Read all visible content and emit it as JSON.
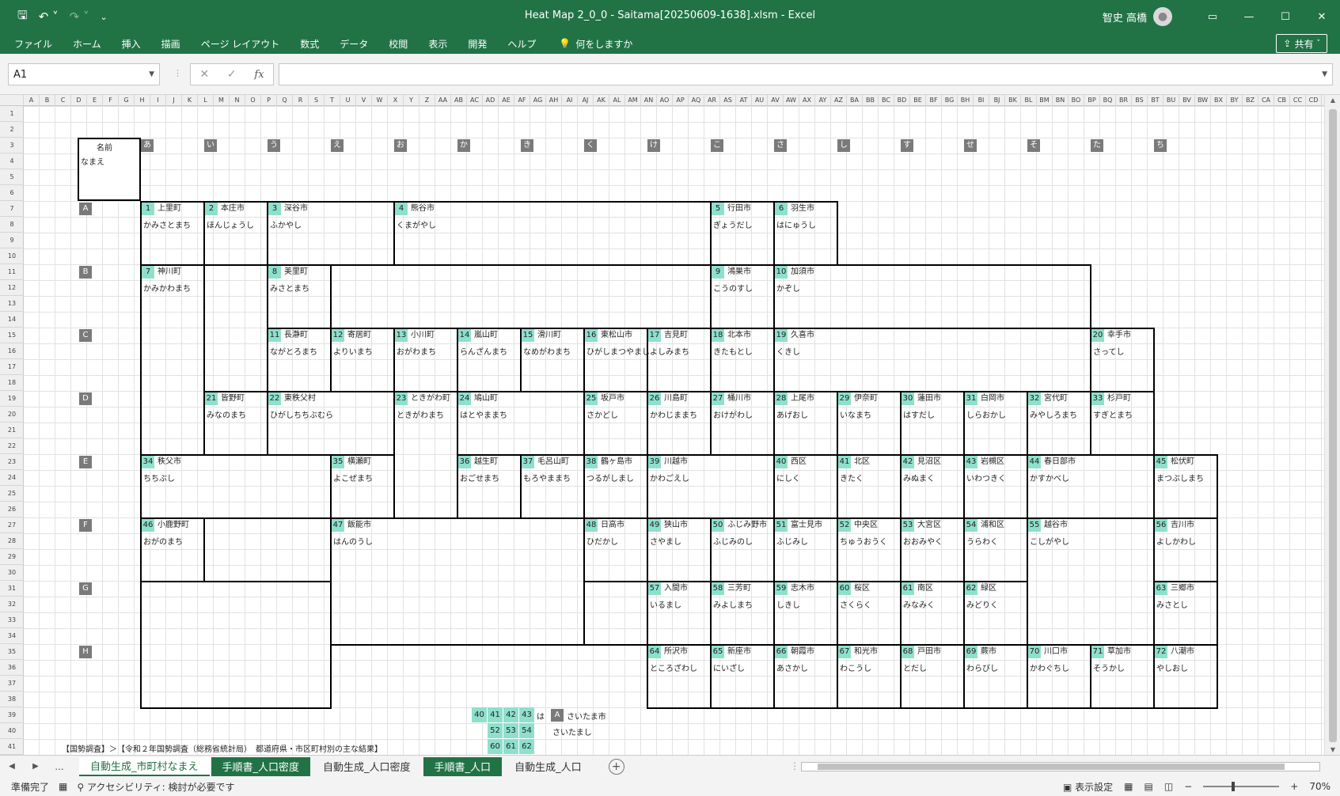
{
  "window": {
    "title": "Heat Map 2_0_0 - Saitama[20250609-1638].xlsm  -  Excel",
    "user_name": "智史 高橋",
    "ribbon_display_icon": "ribbon-display-icon",
    "minimize": "—",
    "maximize": "☐",
    "close": "✕"
  },
  "menu": {
    "items": [
      "ファイル",
      "ホーム",
      "挿入",
      "描画",
      "ページ レイアウト",
      "数式",
      "データ",
      "校閲",
      "表示",
      "開発",
      "ヘルプ"
    ],
    "tell_me": "何をしますか",
    "share": "共有"
  },
  "formula_bar": {
    "name_box": "A1",
    "formula": ""
  },
  "columns": [
    "A",
    "B",
    "C",
    "D",
    "E",
    "F",
    "G",
    "H",
    "I",
    "J",
    "K",
    "L",
    "M",
    "N",
    "O",
    "P",
    "Q",
    "R",
    "S",
    "T",
    "U",
    "V",
    "W",
    "X",
    "Y",
    "Z",
    "AA",
    "AB",
    "AC",
    "AD",
    "AE",
    "AF",
    "AG",
    "AH",
    "AI",
    "AJ",
    "AK",
    "AL",
    "AM",
    "AN",
    "AO",
    "AP",
    "AQ",
    "AR",
    "AS",
    "AT",
    "AU",
    "AV",
    "AW",
    "AX",
    "AY",
    "AZ",
    "BA",
    "BB",
    "BC",
    "BD",
    "BE",
    "BF",
    "BG",
    "BH",
    "BI",
    "BJ",
    "BK",
    "BL",
    "BM",
    "BN",
    "BO",
    "BP",
    "BQ",
    "BR",
    "BS",
    "BT",
    "BU",
    "BV",
    "BW",
    "BX",
    "BY",
    "BZ",
    "CA",
    "CB",
    "CC",
    "CD"
  ],
  "row_count": 41,
  "sheet": {
    "legend": {
      "name_label": "名前",
      "kana_label": "なまえ"
    },
    "col_badges": [
      "あ",
      "い",
      "う",
      "え",
      "お",
      "か",
      "き",
      "く",
      "け",
      "こ",
      "さ",
      "し",
      "す",
      "せ",
      "そ",
      "た",
      "ち"
    ],
    "row_badges": [
      "A",
      "B",
      "C",
      "D",
      "E",
      "F",
      "G",
      "H"
    ],
    "municipalities": [
      {
        "n": "1",
        "name": "上里町",
        "kana": "かみさとまち"
      },
      {
        "n": "2",
        "name": "本庄市",
        "kana": "ほんじょうし"
      },
      {
        "n": "3",
        "name": "深谷市",
        "kana": "ふかやし"
      },
      {
        "n": "4",
        "name": "熊谷市",
        "kana": "くまがやし"
      },
      {
        "n": "5",
        "name": "行田市",
        "kana": "ぎょうだし"
      },
      {
        "n": "6",
        "name": "羽生市",
        "kana": "はにゅうし"
      },
      {
        "n": "7",
        "name": "神川町",
        "kana": "かみかわまち"
      },
      {
        "n": "8",
        "name": "美里町",
        "kana": "みさとまち"
      },
      {
        "n": "9",
        "name": "鴻巣市",
        "kana": "こうのすし"
      },
      {
        "n": "10",
        "name": "加須市",
        "kana": "かぞし"
      },
      {
        "n": "11",
        "name": "長瀞町",
        "kana": "ながとろまち"
      },
      {
        "n": "12",
        "name": "寄居町",
        "kana": "よりいまち"
      },
      {
        "n": "13",
        "name": "小川町",
        "kana": "おがわまち"
      },
      {
        "n": "14",
        "name": "嵐山町",
        "kana": "らんざんまち"
      },
      {
        "n": "15",
        "name": "滑川町",
        "kana": "なめがわまち"
      },
      {
        "n": "16",
        "name": "東松山市",
        "kana": "ひがしまつやまし"
      },
      {
        "n": "17",
        "name": "吉見町",
        "kana": "よしみまち"
      },
      {
        "n": "18",
        "name": "北本市",
        "kana": "きたもとし"
      },
      {
        "n": "19",
        "name": "久喜市",
        "kana": "くきし"
      },
      {
        "n": "20",
        "name": "幸手市",
        "kana": "さってし"
      },
      {
        "n": "21",
        "name": "皆野町",
        "kana": "みなのまち"
      },
      {
        "n": "22",
        "name": "東秩父村",
        "kana": "ひがしちちぶむら"
      },
      {
        "n": "23",
        "name": "ときがわ町",
        "kana": "ときがわまち"
      },
      {
        "n": "24",
        "name": "鳩山町",
        "kana": "はとやままち"
      },
      {
        "n": "25",
        "name": "坂戸市",
        "kana": "さかどし"
      },
      {
        "n": "26",
        "name": "川島町",
        "kana": "かわじままち"
      },
      {
        "n": "27",
        "name": "桶川市",
        "kana": "おけがわし"
      },
      {
        "n": "28",
        "name": "上尾市",
        "kana": "あげおし"
      },
      {
        "n": "29",
        "name": "伊奈町",
        "kana": "いなまち"
      },
      {
        "n": "30",
        "name": "蓮田市",
        "kana": "はすだし"
      },
      {
        "n": "31",
        "name": "白岡市",
        "kana": "しらおかし"
      },
      {
        "n": "32",
        "name": "宮代町",
        "kana": "みやしろまち"
      },
      {
        "n": "33",
        "name": "杉戸町",
        "kana": "すぎとまち"
      },
      {
        "n": "34",
        "name": "秩父市",
        "kana": "ちちぶし"
      },
      {
        "n": "35",
        "name": "横瀬町",
        "kana": "よこぜまち"
      },
      {
        "n": "36",
        "name": "越生町",
        "kana": "おごせまち"
      },
      {
        "n": "37",
        "name": "毛呂山町",
        "kana": "もろやままち"
      },
      {
        "n": "38",
        "name": "鶴ヶ島市",
        "kana": "つるがしまし"
      },
      {
        "n": "39",
        "name": "川越市",
        "kana": "かわごえし"
      },
      {
        "n": "40",
        "name": "西区",
        "kana": "にしく"
      },
      {
        "n": "41",
        "name": "北区",
        "kana": "きたく"
      },
      {
        "n": "42",
        "name": "見沼区",
        "kana": "みぬまく"
      },
      {
        "n": "43",
        "name": "岩槻区",
        "kana": "いわつきく"
      },
      {
        "n": "44",
        "name": "春日部市",
        "kana": "かすかべし"
      },
      {
        "n": "45",
        "name": "松伏町",
        "kana": "まつぶしまち"
      },
      {
        "n": "46",
        "name": "小鹿野町",
        "kana": "おがのまち"
      },
      {
        "n": "47",
        "name": "飯能市",
        "kana": "はんのうし"
      },
      {
        "n": "48",
        "name": "日高市",
        "kana": "ひだかし"
      },
      {
        "n": "49",
        "name": "狭山市",
        "kana": "さやまし"
      },
      {
        "n": "50",
        "name": "ふじみ野市",
        "kana": "ふじみのし"
      },
      {
        "n": "51",
        "name": "富士見市",
        "kana": "ふじみし"
      },
      {
        "n": "52",
        "name": "中央区",
        "kana": "ちゅうおうく"
      },
      {
        "n": "53",
        "name": "大宮区",
        "kana": "おおみやく"
      },
      {
        "n": "54",
        "name": "浦和区",
        "kana": "うらわく"
      },
      {
        "n": "55",
        "name": "越谷市",
        "kana": "こしがやし"
      },
      {
        "n": "56",
        "name": "吉川市",
        "kana": "よしかわし"
      },
      {
        "n": "57",
        "name": "入間市",
        "kana": "いるまし"
      },
      {
        "n": "58",
        "name": "三芳町",
        "kana": "みよしまち"
      },
      {
        "n": "59",
        "name": "志木市",
        "kana": "しきし"
      },
      {
        "n": "60",
        "name": "桜区",
        "kana": "さくらく"
      },
      {
        "n": "61",
        "name": "南区",
        "kana": "みなみく"
      },
      {
        "n": "62",
        "name": "緑区",
        "kana": "みどりく"
      },
      {
        "n": "63",
        "name": "三郷市",
        "kana": "みさとし"
      },
      {
        "n": "64",
        "name": "所沢市",
        "kana": "ところざわし"
      },
      {
        "n": "65",
        "name": "新座市",
        "kana": "にいざし"
      },
      {
        "n": "66",
        "name": "朝霞市",
        "kana": "あさかし"
      },
      {
        "n": "67",
        "name": "和光市",
        "kana": "わこうし"
      },
      {
        "n": "68",
        "name": "戸田市",
        "kana": "とだし"
      },
      {
        "n": "69",
        "name": "蕨市",
        "kana": "わらびし"
      },
      {
        "n": "70",
        "name": "川口市",
        "kana": "かわぐちし"
      },
      {
        "n": "71",
        "name": "草加市",
        "kana": "そうかし"
      },
      {
        "n": "72",
        "name": "八潮市",
        "kana": "やしおし"
      }
    ],
    "saitama": {
      "badge": "A",
      "name": "さいたま市",
      "kana": "さいたまし",
      "ha": "は",
      "wards_row1": [
        "40",
        "41",
        "42",
        "43"
      ],
      "wards_row2": [
        "52",
        "53",
        "54"
      ],
      "wards_row3": [
        "60",
        "61",
        "62"
      ]
    },
    "source_line": "【国勢調査】＞【令和２年国勢調査（総務省統計局）　都道府県・市区町村別の主な結果】",
    "source_url": "https://www.e-stat.go.jp/stat-search/files?page=1&layout=datalist&toukei=00200521&tstat=000001049104&cycle=0&tclass1=000001049105&tclass2val=0"
  },
  "tabs": {
    "more": "...",
    "items": [
      {
        "label": "自動生成_市町村なまえ",
        "style": "active"
      },
      {
        "label": "手順書_人口密度",
        "style": "green"
      },
      {
        "label": "自動生成_人口密度",
        "style": "plain"
      },
      {
        "label": "手順書_人口",
        "style": "green"
      },
      {
        "label": "自動生成_人口",
        "style": "plain"
      }
    ]
  },
  "status": {
    "ready": "準備完了",
    "accessibility": "アクセシビリティ: 検討が必要です",
    "display_settings": "表示設定",
    "zoom": "70%",
    "zoom_minus": "−",
    "zoom_plus": "+"
  },
  "colors": {
    "excel_green": "#217346",
    "number_teal": "#8ee0cc",
    "badge_gray": "#7a7a7a"
  }
}
